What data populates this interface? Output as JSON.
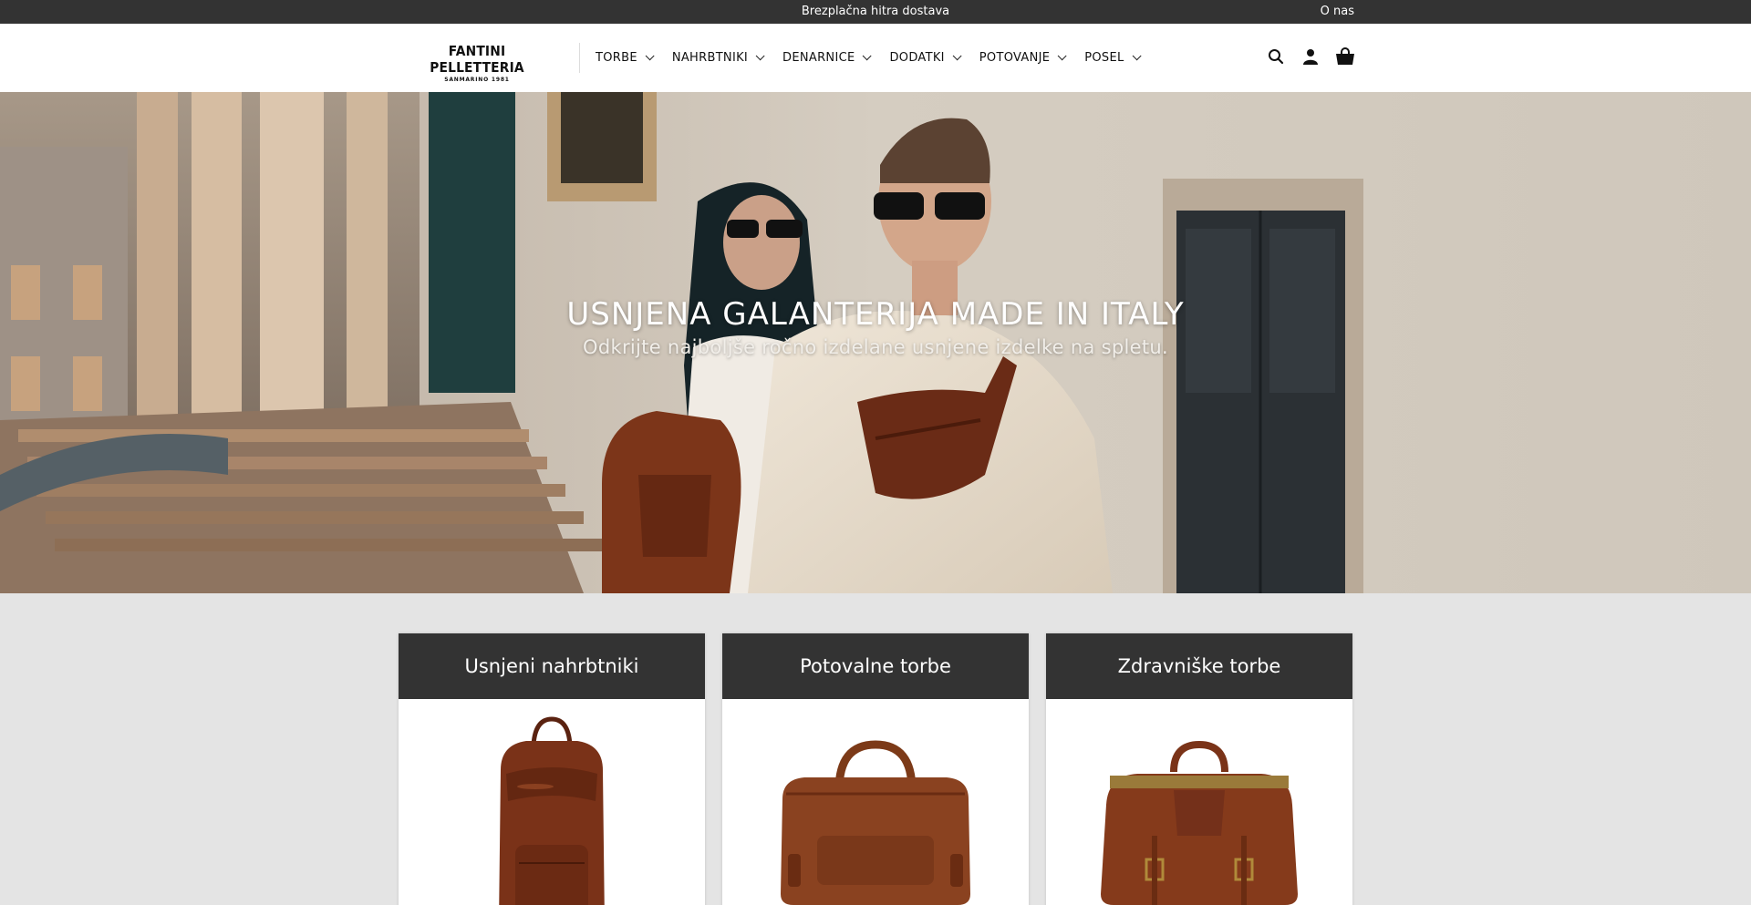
{
  "topbar": {
    "promo_text": "Brezplačna hitra dostava",
    "about_link": "O nas"
  },
  "header": {
    "logo_line1": "FANTINI PELLETTERIA",
    "logo_line2": "SANMARINO 1981",
    "nav": [
      {
        "label": "TORBE"
      },
      {
        "label": "NAHRBTNIKI"
      },
      {
        "label": "DENARNICE"
      },
      {
        "label": "DODATKI"
      },
      {
        "label": "POTOVANJE"
      },
      {
        "label": "POSEL"
      }
    ],
    "icons": [
      "search-icon",
      "account-icon",
      "cart-icon"
    ]
  },
  "hero": {
    "title": "USNJENA GALANTERIJA MADE IN ITALY",
    "subtitle": "Odkrijte najboljše ročno izdelane usnjene izdelke na spletu."
  },
  "categories": [
    {
      "title": "Usnjeni nahrbtniki"
    },
    {
      "title": "Potovalne torbe"
    },
    {
      "title": "Zdravniške torbe"
    }
  ],
  "colors": {
    "dark_bar": "#333333",
    "page_bg": "#e4e4e4",
    "leather": "#7a3218"
  }
}
